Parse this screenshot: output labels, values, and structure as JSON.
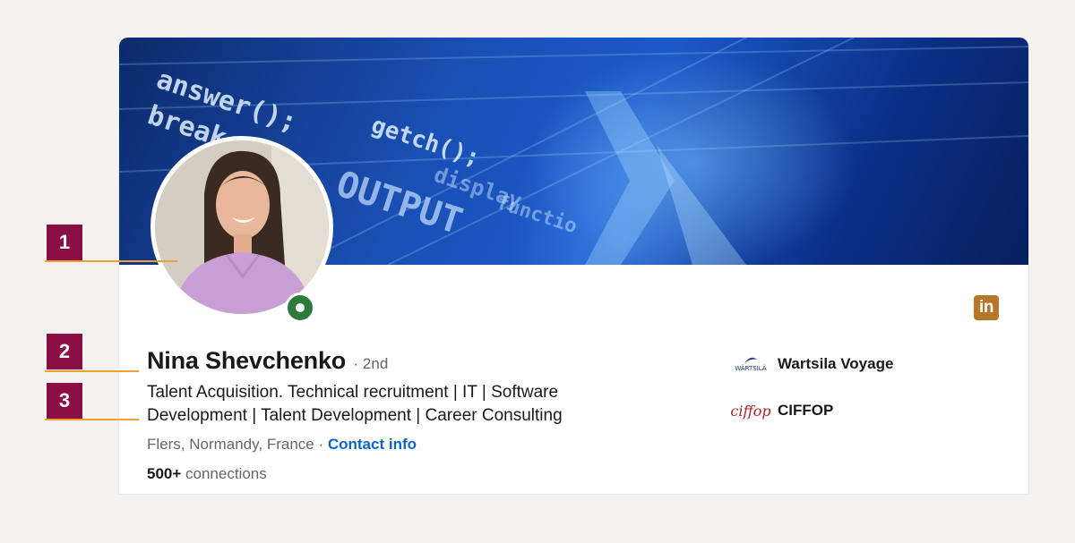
{
  "profile": {
    "name": "Nina Shevchenko",
    "degree": "· 2nd",
    "headline": "Talent Acquisition. Technical recruitment | IT | Software Development | Talent Development | Career Consulting",
    "location": "Flers, Normandy, France · ",
    "contact_info": "Contact info",
    "connections_count": "500+",
    "connections_label": " connections",
    "status": "open-to-work"
  },
  "companies": [
    {
      "name": "Wartsila Voyage",
      "logo_text": "WÄRTSILÄ",
      "icon": "wartsila-logo"
    },
    {
      "name": "CIFFOP",
      "logo_text": "ciffop",
      "icon": "ciffop-logo"
    }
  ],
  "brand": {
    "logo_text": "in",
    "icon": "linkedin-logo"
  },
  "annotations": [
    "1",
    "2",
    "3"
  ],
  "colors": {
    "annotation_badge": "#8b0f45",
    "leader_line": "#f0a033",
    "link": "#0a66c2",
    "status_green": "#2d7a3c",
    "linkedin_brand": "#b8762a"
  },
  "banner_code": [
    "answer();",
    "break;",
    "getch();",
    "OUTPUT",
    "display",
    "functio"
  ]
}
